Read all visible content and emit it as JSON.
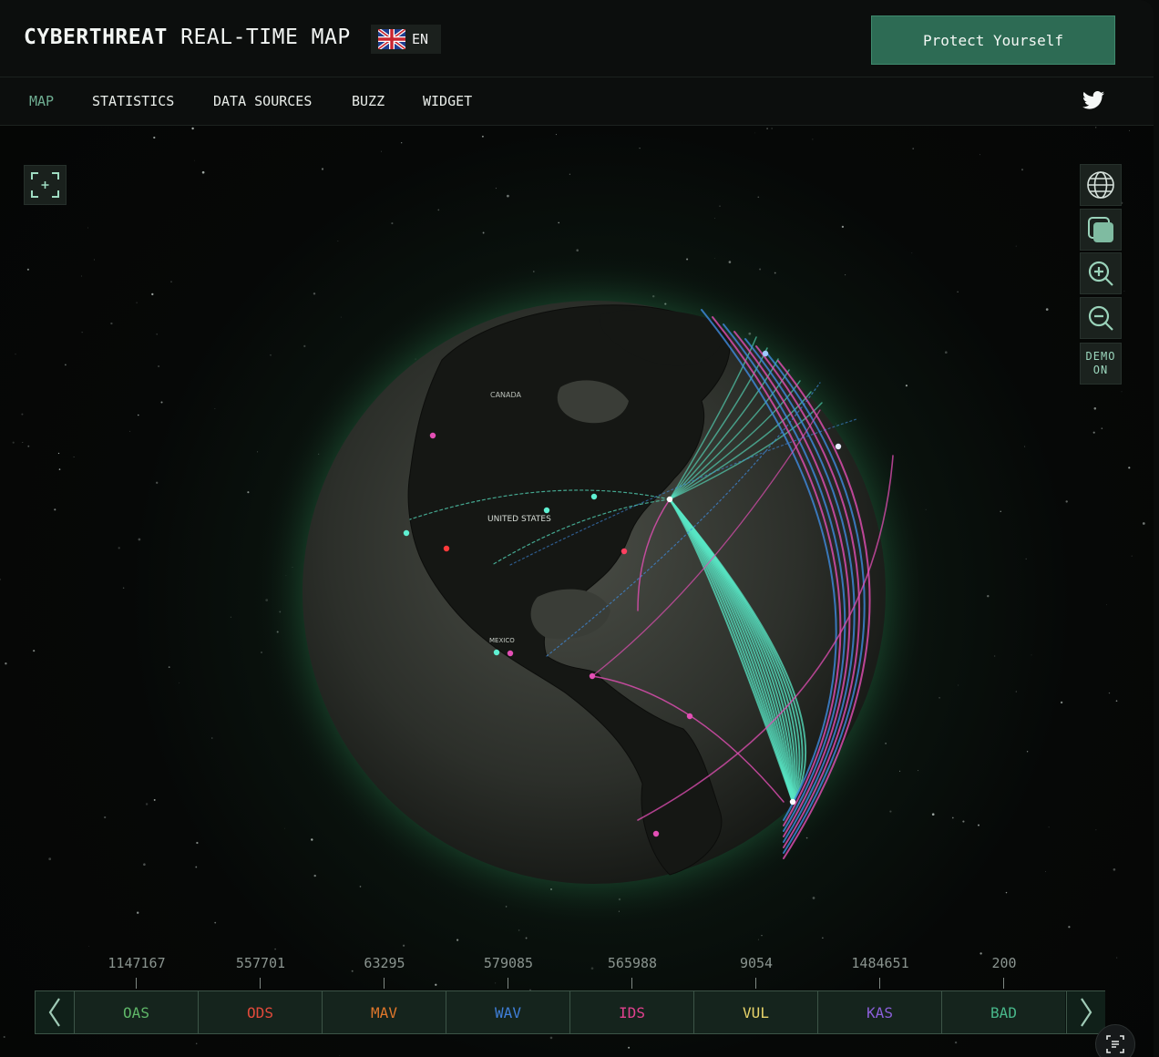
{
  "header": {
    "title_bold": "CYBERTHREAT",
    "title_rest": " REAL-TIME MAP",
    "language": "EN",
    "cta_label": "Protect Yourself"
  },
  "nav": {
    "items": [
      {
        "label": "MAP",
        "active": true
      },
      {
        "label": "STATISTICS"
      },
      {
        "label": "DATA SOURCES"
      },
      {
        "label": "BUZZ"
      },
      {
        "label": "WIDGET"
      }
    ]
  },
  "map": {
    "labels": {
      "canada": "CANADA",
      "usa": "UNITED STATES",
      "mexico": "MEXICO"
    },
    "controls": {
      "demo_line1": "DEMO",
      "demo_line2": "ON"
    }
  },
  "stats": [
    {
      "code": "OAS",
      "value": "1147167",
      "color": "#5fb768"
    },
    {
      "code": "ODS",
      "value": "557701",
      "color": "#e24a3b"
    },
    {
      "code": "MAV",
      "value": "63295",
      "color": "#e0772b"
    },
    {
      "code": "WAV",
      "value": "579085",
      "color": "#3f7fd9"
    },
    {
      "code": "IDS",
      "value": "565988",
      "color": "#e0418e"
    },
    {
      "code": "VUL",
      "value": "9054",
      "color": "#e8d46a"
    },
    {
      "code": "KAS",
      "value": "1484651",
      "color": "#8b5fd9"
    },
    {
      "code": "BAD",
      "value": "200",
      "color": "#48b78a"
    }
  ],
  "colors": {
    "accent": "#2d6b54",
    "active_nav": "#6fae92",
    "arc_cyan": "#58e6c4",
    "arc_magenta": "#e34fb5",
    "arc_blue": "#3f8be0"
  }
}
